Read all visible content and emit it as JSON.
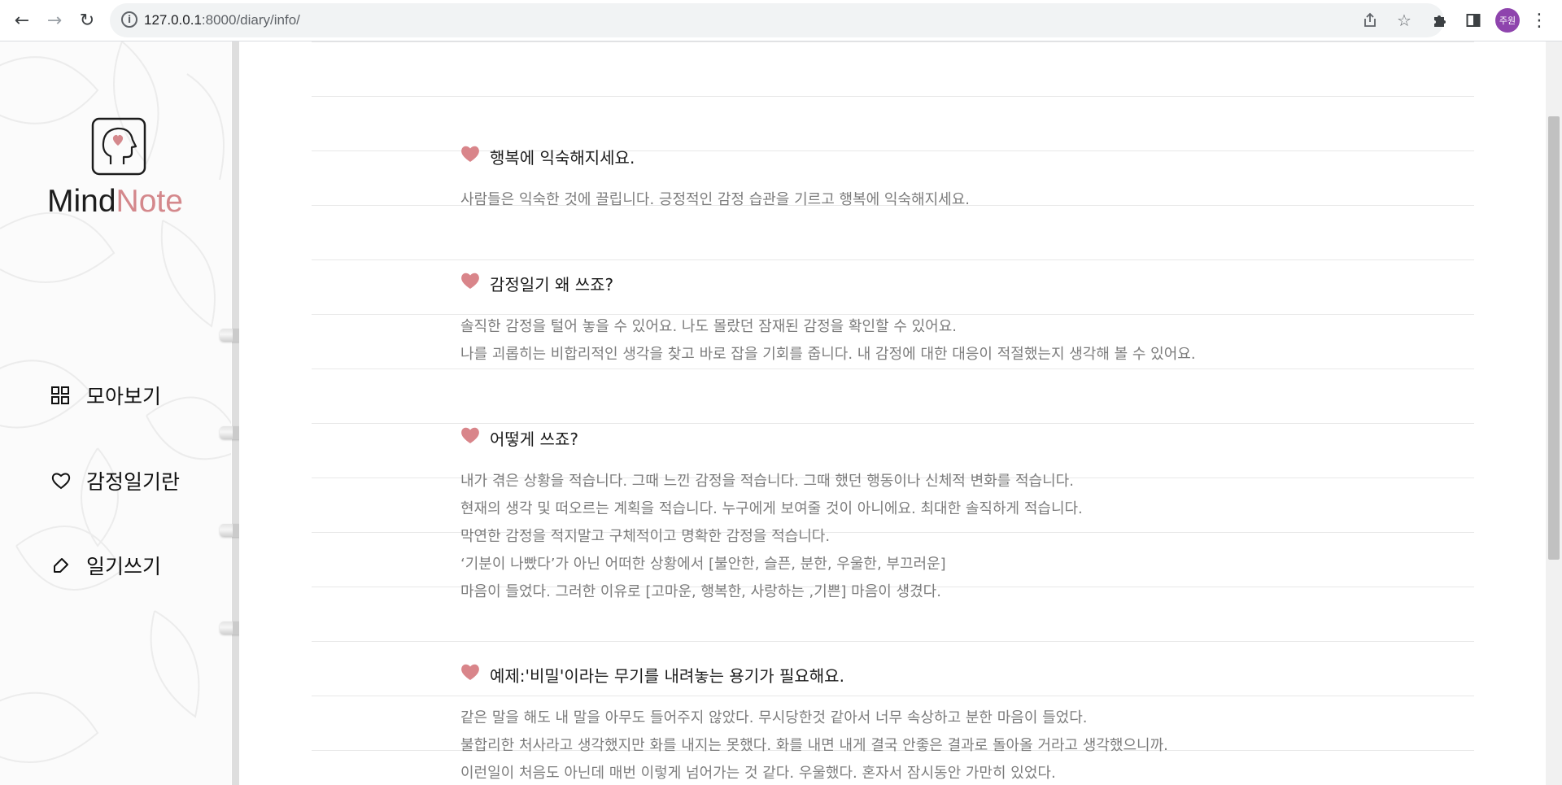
{
  "browser": {
    "url_host": "127.0.0.1",
    "url_rest": ":8000/diary/info/",
    "profile_label": "주원"
  },
  "sidebar": {
    "logo_word_1": "Mind",
    "logo_word_2": "Note",
    "items": [
      {
        "label": "모아보기",
        "icon": "grid-icon"
      },
      {
        "label": "감정일기란",
        "icon": "heart-outline-icon"
      },
      {
        "label": "일기쓰기",
        "icon": "pen-tag-icon"
      }
    ]
  },
  "sections": [
    {
      "title": "행복에 익숙해지세요.",
      "lines": [
        "사람들은 익숙한 것에 끌립니다. 긍정적인 감정 습관을 기르고 행복에 익숙해지세요."
      ]
    },
    {
      "title": "감정일기 왜 쓰죠?",
      "lines": [
        "솔직한 감정을 털어 놓을 수 있어요. 나도 몰랐던 잠재된 감정을 확인할 수 있어요.",
        "나를 괴롭히는 비합리적인 생각을 찾고 바로 잡을 기회를 줍니다. 내 감정에 대한 대응이 적절했는지 생각해 볼 수 있어요."
      ]
    },
    {
      "title": "어떻게 쓰죠?",
      "lines": [
        "내가 겪은 상황을 적습니다. 그때 느낀 감정을 적습니다. 그때 했던 행동이나 신체적 변화를 적습니다.",
        "현재의 생각 및 떠오르는 계획을 적습니다. 누구에게 보여줄 것이 아니에요. 최대한 솔직하게 적습니다.",
        "막연한 감정을 적지말고 구체적이고 명확한 감정을 적습니다.",
        "‘기분이 나빴다’가 아닌 어떠한 상황에서 [불안한, 슬픈, 분한, 우울한, 부끄러운]",
        "마음이 들었다. 그러한 이유로 [고마운, 행복한, 사랑하는 ,기쁜] 마음이 생겼다."
      ]
    },
    {
      "title": "예제:'비밀'이라는 무기를 내려놓는 용기가 필요해요.",
      "lines": [
        "같은 말을 해도 내 말을 아무도 들어주지 않았다. 무시당한것 같아서 너무 속상하고 분한 마음이 들었다.",
        "불합리한 처사라고 생각했지만 화를 내지는 못했다. 화를 내면 내게 결국 안좋은 결과로 돌아올 거라고 생각했으니까.",
        "이런일이 처음도 아닌데 매번 이렇게 넘어가는 것 같다. 우울했다. 혼자서 잠시동안 가만히 있었다."
      ]
    }
  ],
  "colors": {
    "accent_pink": "#d4888c",
    "heart": "#d9858a"
  }
}
